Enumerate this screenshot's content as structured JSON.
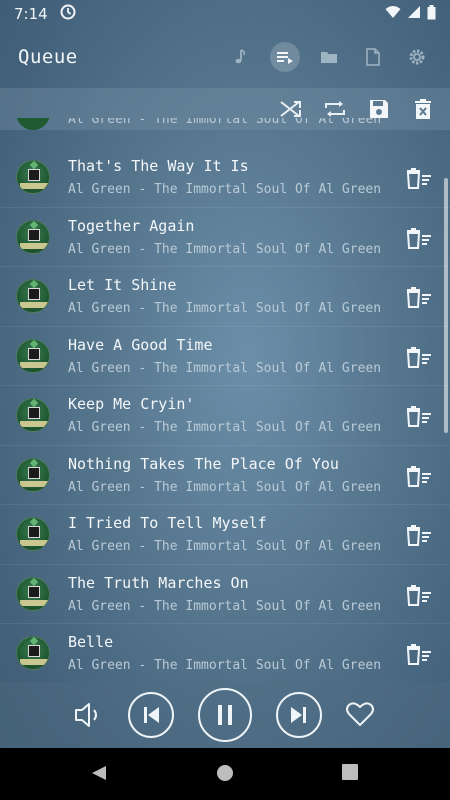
{
  "status": {
    "time": "7:14"
  },
  "appbar": {
    "title": "Queue",
    "tabs": [
      {
        "icon": "music-note-icon"
      },
      {
        "icon": "queue-icon",
        "active": true
      },
      {
        "icon": "folder-icon"
      },
      {
        "icon": "file-icon"
      },
      {
        "icon": "settings-icon"
      }
    ]
  },
  "toolbar": {
    "actions": [
      "shuffle-icon",
      "repeat-icon",
      "save-icon",
      "clear-queue-icon"
    ]
  },
  "queue": {
    "partial_subtitle": "Al Green - The Immortal Soul Of Al Green",
    "items": [
      {
        "title": "That's The Way It Is",
        "subtitle": "Al Green - The Immortal Soul Of Al Green"
      },
      {
        "title": "Together Again",
        "subtitle": "Al Green - The Immortal Soul Of Al Green"
      },
      {
        "title": "Let It Shine",
        "subtitle": "Al Green - The Immortal Soul Of Al Green"
      },
      {
        "title": "Have A Good Time",
        "subtitle": "Al Green - The Immortal Soul Of Al Green"
      },
      {
        "title": "Keep Me Cryin'",
        "subtitle": "Al Green - The Immortal Soul Of Al Green"
      },
      {
        "title": "Nothing Takes The Place Of You",
        "subtitle": "Al Green - The Immortal Soul Of Al Green"
      },
      {
        "title": "I Tried To Tell Myself",
        "subtitle": "Al Green - The Immortal Soul Of Al Green"
      },
      {
        "title": "The Truth Marches On",
        "subtitle": "Al Green - The Immortal Soul Of Al Green"
      },
      {
        "title": "Belle",
        "subtitle": "Al Green - The Immortal Soul Of Al Green"
      }
    ]
  },
  "player": {
    "state": "playing",
    "favorite": false
  },
  "colors": {
    "background": "#4f6f87",
    "text": "#f4f7f9",
    "subtext": "#b9cad6"
  }
}
